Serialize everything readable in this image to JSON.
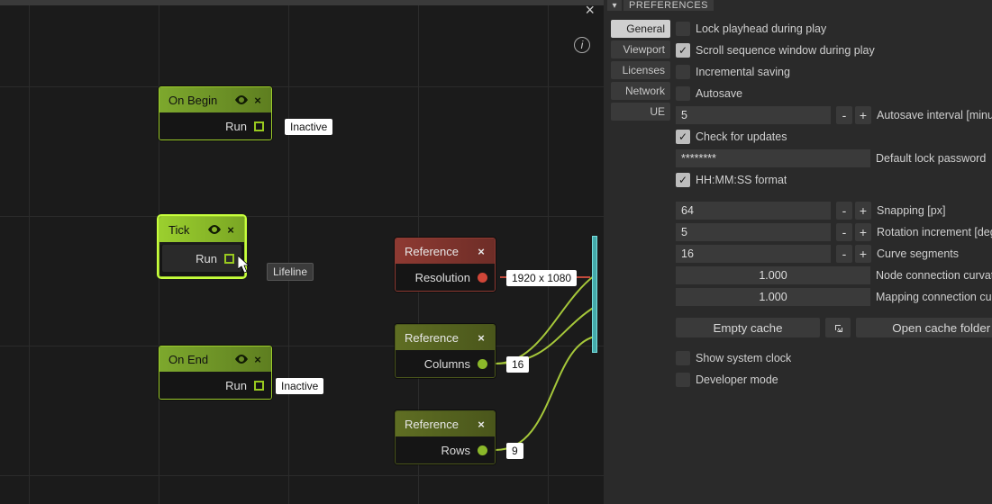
{
  "editor": {
    "nodes": {
      "on_begin": {
        "title": "On Begin",
        "run": "Run",
        "tag": "Inactive"
      },
      "tick": {
        "title": "Tick",
        "run": "Run",
        "tooltip": "Lifeline"
      },
      "on_end": {
        "title": "On End",
        "run": "Run",
        "tag": "Inactive"
      },
      "ref_res": {
        "title": "Reference",
        "label": "Resolution",
        "value": "1920 x 1080"
      },
      "ref_cols": {
        "title": "Reference",
        "label": "Columns",
        "value": "16"
      },
      "ref_rows": {
        "title": "Reference",
        "label": "Rows",
        "value": "9"
      }
    },
    "icons": {
      "eye": "eye-icon",
      "close": "close-icon",
      "info": "info-icon"
    }
  },
  "prefs": {
    "panel_title": "PREFERENCES",
    "categories": [
      "General",
      "Viewport",
      "Licenses",
      "Network",
      "UE"
    ],
    "active_category": 0,
    "options": {
      "lock_playhead": {
        "label": "Lock playhead during play",
        "checked": false
      },
      "scroll_seq": {
        "label": "Scroll sequence window during play",
        "checked": true
      },
      "inc_save": {
        "label": "Incremental saving",
        "checked": false
      },
      "autosave": {
        "label": "Autosave",
        "checked": false
      },
      "autosave_int": {
        "label": "Autosave interval [minutes]",
        "value": "5"
      },
      "check_upd": {
        "label": "Check for updates",
        "checked": true
      },
      "lock_pw": {
        "label": "Default lock password",
        "value": "********"
      },
      "hhmmss": {
        "label": "HH:MM:SS format",
        "checked": true
      },
      "snap": {
        "label": "Snapping [px]",
        "value": "64"
      },
      "rot_inc": {
        "label": "Rotation increment [degrees]",
        "value": "5"
      },
      "curve_seg": {
        "label": "Curve segments",
        "value": "16"
      },
      "node_curv": {
        "label": "Node connection curvature",
        "value": "1.000"
      },
      "map_curv": {
        "label": "Mapping connection curvature",
        "value": "1.000"
      },
      "empty_cache": "Empty cache",
      "open_cache": "Open cache folder",
      "sys_clock": {
        "label": "Show system clock",
        "checked": false
      },
      "dev_mode": {
        "label": "Developer mode",
        "checked": false
      }
    }
  }
}
